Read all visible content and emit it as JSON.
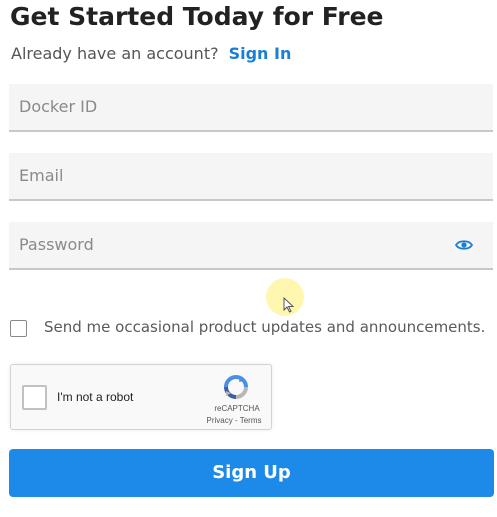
{
  "header": {
    "title": "Get Started Today for Free",
    "subtitle": "Already have an account?",
    "sign_in_link": "Sign In"
  },
  "form": {
    "docker_id": {
      "placeholder": "Docker ID",
      "value": ""
    },
    "email": {
      "placeholder": "Email",
      "value": ""
    },
    "password": {
      "placeholder": "Password",
      "value": "",
      "toggle_icon": "eye-icon"
    }
  },
  "updates_checkbox": {
    "label": "Send me occasional product updates and announcements.",
    "checked": false
  },
  "recaptcha": {
    "label": "I'm not a robot",
    "brand": "reCAPTCHA",
    "terms": "Privacy - Terms",
    "checked": false
  },
  "submit": {
    "label": "Sign Up"
  },
  "colors": {
    "accent": "#1d8aea",
    "link": "#1a7fd4",
    "field_bg": "#f5f5f5"
  }
}
